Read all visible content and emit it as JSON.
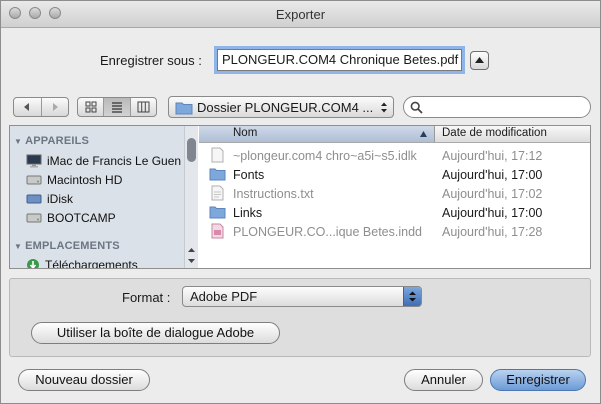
{
  "window": {
    "title": "Exporter"
  },
  "save": {
    "label": "Enregistrer sous :",
    "filename": "PLONGEUR.COM4 Chronique Betes.pdf"
  },
  "toolbar": {
    "path_popup": "Dossier PLONGEUR.COM4 ...",
    "search_placeholder": ""
  },
  "sidebar": {
    "sections": [
      {
        "title": "APPAREILS",
        "items": [
          {
            "label": "iMac de Francis Le Guen",
            "icon": "imac-icon"
          },
          {
            "label": "Macintosh HD",
            "icon": "hard-drive-icon"
          },
          {
            "label": "iDisk",
            "icon": "idisk-icon"
          },
          {
            "label": "BOOTCAMP",
            "icon": "hard-drive-icon"
          }
        ]
      },
      {
        "title": "EMPLACEMENTS",
        "items": [
          {
            "label": "Téléchargements",
            "icon": "downloads-icon"
          }
        ]
      }
    ]
  },
  "file_list": {
    "columns": {
      "name": "Nom",
      "date": "Date de modification"
    },
    "rows": [
      {
        "name": "~plongeur.com4 chro~a5i~s5.idlk",
        "date": "Aujourd'hui, 17:12",
        "kind": "file",
        "enabled": false
      },
      {
        "name": "Fonts",
        "date": "Aujourd'hui, 17:00",
        "kind": "folder",
        "enabled": true
      },
      {
        "name": "Instructions.txt",
        "date": "Aujourd'hui, 17:02",
        "kind": "file",
        "enabled": false
      },
      {
        "name": "Links",
        "date": "Aujourd'hui, 17:00",
        "kind": "folder",
        "enabled": true
      },
      {
        "name": "PLONGEUR.CO...ique Betes.indd",
        "date": "Aujourd'hui, 17:28",
        "kind": "indd",
        "enabled": false
      }
    ]
  },
  "options": {
    "format_label": "Format :",
    "format_value": "Adobe PDF",
    "adobe_dialog_button": "Utiliser la boîte de dialogue Adobe"
  },
  "buttons": {
    "new_folder": "Nouveau dossier",
    "cancel": "Annuler",
    "save": "Enregistrer"
  },
  "colors": {
    "accent": "#6c9ad6",
    "folder": "#6f9fd8",
    "sidebar": "#dbe1e8"
  }
}
